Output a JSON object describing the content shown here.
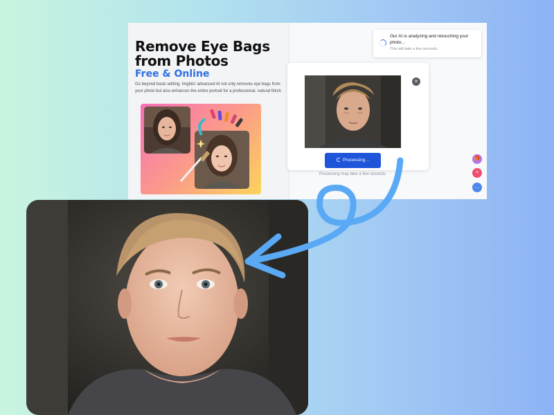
{
  "hero": {
    "title": "Remove Eye Bags from Photos",
    "subtitle": "Free & Online",
    "description": "Go beyond basic editing. Imgkits' advanced AI not only removes eye bags from your photo but also enhances the entire portrait for a professional, natural finish."
  },
  "toast": {
    "message": "Our AI is analyzing and retouching your photo...",
    "note": "This will take a few seconds."
  },
  "card": {
    "close_icon": "×",
    "button_label": "Processing ..",
    "note": "Processing may take a few seconds"
  },
  "fabs": {
    "gift_icon": "🎁",
    "share_icon": "<",
    "chat_icon": "…"
  },
  "colors": {
    "accent_blue": "#2f6fe4",
    "button_blue": "#1f55d9",
    "arrow_blue": "#5aa9f5",
    "background_start": "#c9f5df",
    "background_end": "#8db3f5"
  }
}
